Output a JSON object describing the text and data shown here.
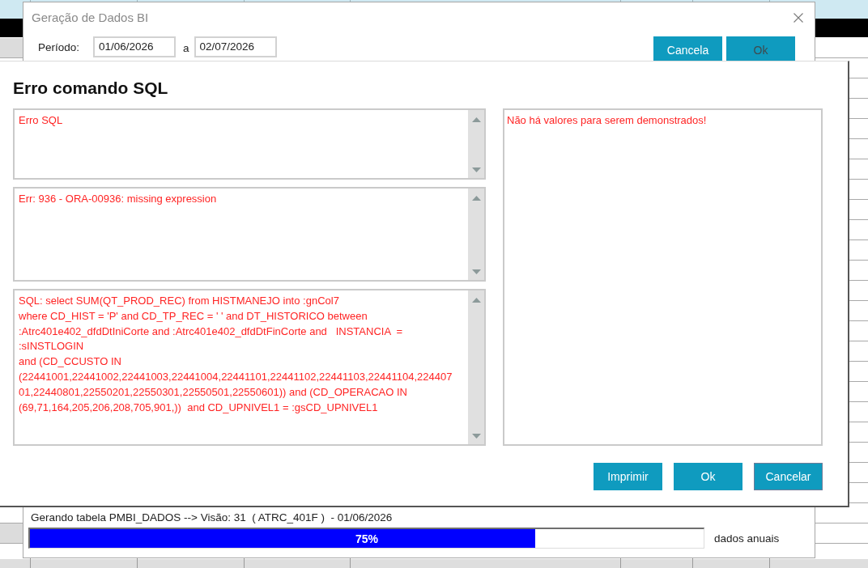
{
  "generation_window": {
    "title": "Geração de Dados BI",
    "period": {
      "label": "Período:",
      "start": "01/06/2026",
      "separator": "a",
      "end": "02/07/2026"
    },
    "buttons": [
      {
        "label": "Cancela",
        "disabled": false
      },
      {
        "label": "Ok",
        "disabled": true
      }
    ],
    "status": "Gerando tabela PMBI_DADOS --> Visão: 31  ( ATRC_401F )  - 01/06/2026",
    "progress": {
      "level": 0.75,
      "reading": "75%"
    },
    "progress_caption": "dados anuais"
  },
  "error_dialog": {
    "title": "Erro comando SQL",
    "messages": [
      "Erro SQL",
      "Err: 936 - ORA-00936: missing expression",
      "SQL: select SUM(QT_PROD_REC) from HISTMANEJO into :gnCol7\nwhere CD_HIST = 'P' and CD_TP_REC = ' ' and DT_HISTORICO between\n:Atrc401e402_dfdDtIniCorte and :Atrc401e402_dfdDtFinCorte and   INSTANCIA  =\n:sINSTLOGIN\nand (CD_CCUSTO IN\n(22441001,22441002,22441003,22441004,22441101,22441102,22441103,22441104,224407\n01,22440801,22550201,22550301,22550501,22550601)) and (CD_OPERACAO IN\n(69,71,164,205,206,208,705,901,))  and CD_UPNIVEL1 = :gsCD_UPNIVEL1"
    ],
    "result": "Não há valores para serem demonstrados!",
    "buttons": [
      {
        "label": "Imprimir",
        "focused": false
      },
      {
        "label": "Ok",
        "focused": false
      },
      {
        "label": "Cancelar",
        "focused": true
      }
    ]
  }
}
